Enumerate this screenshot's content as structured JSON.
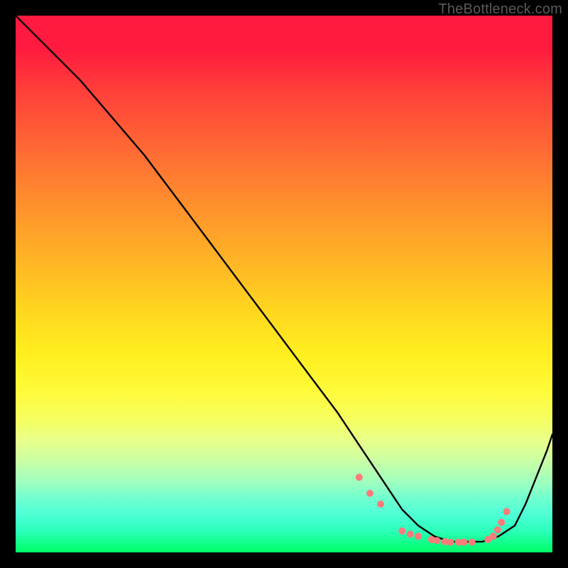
{
  "watermark": "TheBottleneck.com",
  "chart_data": {
    "type": "line",
    "title": "",
    "xlabel": "",
    "ylabel": "",
    "xlim": [
      0,
      100
    ],
    "ylim": [
      0,
      100
    ],
    "grid": false,
    "series": [
      {
        "name": "curve",
        "x": [
          0,
          3,
          7,
          12,
          18,
          24,
          30,
          36,
          42,
          48,
          54,
          60,
          64,
          68,
          72,
          75,
          78,
          81,
          84,
          87,
          90,
          93,
          95,
          97,
          99,
          100
        ],
        "y": [
          100,
          97,
          93,
          88,
          81,
          74,
          66,
          58,
          50,
          42,
          34,
          26,
          20,
          14,
          8,
          5,
          3,
          2,
          2,
          2,
          3,
          5,
          9,
          14,
          19,
          22
        ]
      }
    ],
    "markers": {
      "name": "dots",
      "color": "#ff7a7a",
      "radius": 5,
      "x": [
        64,
        66,
        68,
        72,
        73.5,
        75,
        77.5,
        78.5,
        80,
        81,
        82.5,
        83.5,
        85,
        88,
        89,
        89.8,
        90.5,
        91.5
      ],
      "y": [
        14,
        11,
        9,
        4,
        3.4,
        3,
        2.4,
        2.2,
        2,
        1.9,
        1.9,
        1.9,
        1.9,
        2.4,
        3,
        4.2,
        5.6,
        7.6
      ]
    }
  }
}
